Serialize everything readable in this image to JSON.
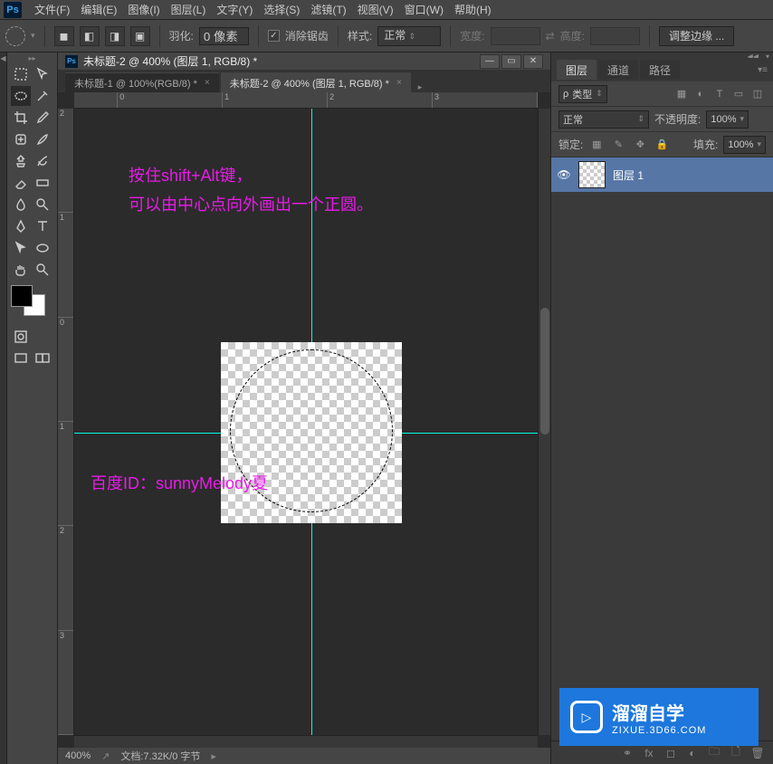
{
  "app": {
    "logo": "Ps"
  },
  "menu": [
    "文件(F)",
    "编辑(E)",
    "图像(I)",
    "图层(L)",
    "文字(Y)",
    "选择(S)",
    "滤镜(T)",
    "视图(V)",
    "窗口(W)",
    "帮助(H)"
  ],
  "options": {
    "feather_label": "羽化:",
    "feather_value": "0 像素",
    "antialias_label": "消除锯齿",
    "style_label": "样式:",
    "style_value": "正常",
    "width_label": "宽度:",
    "height_label": "高度:",
    "refine_edge": "调整边缘 ..."
  },
  "document": {
    "title": "未标题-2 @ 400% (图层 1, RGB/8) *",
    "tabs": [
      {
        "label": "未标题-1 @ 100%(RGB/8) *",
        "active": false
      },
      {
        "label": "未标题-2 @ 400% (图层 1, RGB/8) *",
        "active": true
      }
    ],
    "ruler_h": [
      "0",
      "1",
      "2",
      "3"
    ],
    "ruler_v": [
      "2",
      "1",
      "0",
      "1",
      "2",
      "3"
    ],
    "zoom": "400%",
    "doc_info": "文档:7.32K/0 字节",
    "annotation_line1": "按住shift+Alt键，",
    "annotation_line2": "可以由中心点向外画出一个正圆。",
    "annotation_credit": "百度ID：sunnyMelody夏"
  },
  "layers_panel": {
    "tabs": [
      "图层",
      "通道",
      "路径"
    ],
    "kind_label": "类型",
    "blend_mode": "正常",
    "opacity_label": "不透明度:",
    "opacity_value": "100%",
    "lock_label": "锁定:",
    "fill_label": "填充:",
    "fill_value": "100%",
    "layers": [
      {
        "name": "图层 1",
        "visible": true,
        "selected": true
      }
    ]
  },
  "watermark": {
    "brand": "溜溜自学",
    "url": "ZIXUE.3D66.COM"
  }
}
